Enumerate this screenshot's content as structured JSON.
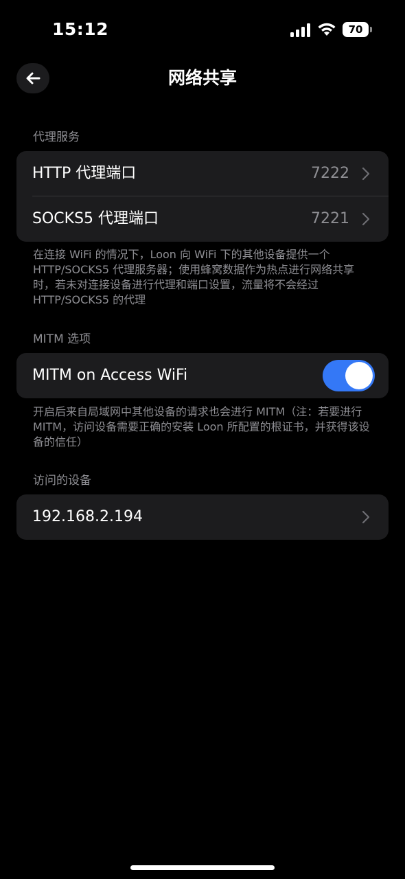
{
  "status_bar": {
    "time": "15:12",
    "battery": "70",
    "icons": [
      "signal-icon",
      "wifi-icon",
      "battery-icon"
    ]
  },
  "nav": {
    "back_icon": "arrow-left-icon",
    "title": "网络共享"
  },
  "proxy_section": {
    "header": "代理服务",
    "rows": [
      {
        "label": "HTTP 代理端口",
        "value": "7222"
      },
      {
        "label": "SOCKS5 代理端口",
        "value": "7221"
      }
    ],
    "footer": "在连接 WiFi 的情况下，Loon 向 WiFi 下的其他设备提供一个 HTTP/SOCKS5 代理服务器；使用蜂窝数据作为热点进行网络共享时，若未对连接设备进行代理和端口设置，流量将不会经过 HTTP/SOCKS5 的代理"
  },
  "mitm_section": {
    "header": "MITM 选项",
    "toggle_label": "MITM on Access WiFi",
    "toggle_on": true,
    "footer": "开启后来自局域网中其他设备的请求也会进行 MITM（注：若要进行 MITM，访问设备需要正确的安装 Loon 所配置的根证书，并获得该设备的信任）"
  },
  "devices_section": {
    "header": "访问的设备",
    "devices": [
      "192.168.2.194"
    ]
  },
  "colors": {
    "background": "#000000",
    "card": "#1c1c1e",
    "secondary_text": "#8e8e93",
    "accent": "#3478f6"
  }
}
